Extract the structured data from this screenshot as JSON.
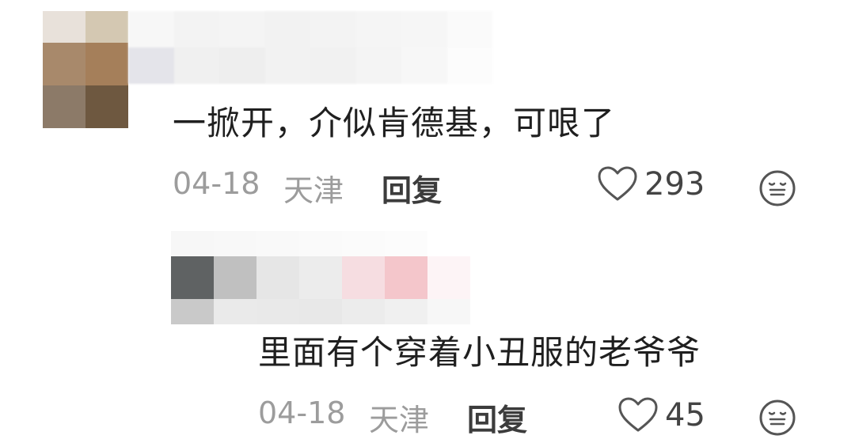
{
  "comments": [
    {
      "text": "一掀开，介似肯德基，可哏了",
      "date": "04-18",
      "location": "天津",
      "reply_label": "回复",
      "likes": "293"
    },
    {
      "text": "里面有个穿着小丑服的老爷爷",
      "date": "04-18",
      "location": "天津",
      "reply_label": "回复",
      "likes": "45"
    }
  ],
  "colors": {
    "text": "#1f1f1f",
    "meta": "#9c9c9c",
    "reply": "#3c3c3c",
    "icon": "#555555"
  }
}
